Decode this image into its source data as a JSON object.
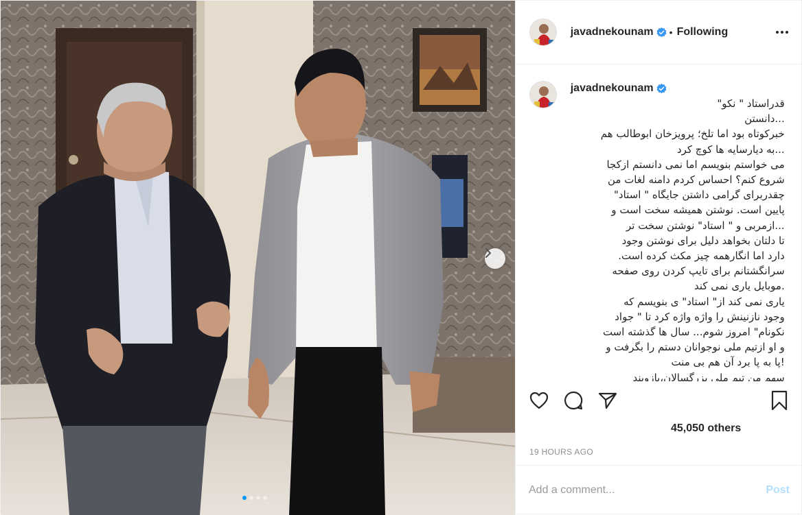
{
  "post": {
    "author": {
      "username": "javadnekounam",
      "verified": true,
      "follow_status": "Following",
      "separator": "•"
    },
    "caption": {
      "username": "javadnekounam",
      "text": "قدراستاد \" نکو\"\n...دانستن\nخبرکوتاه بود اما تلخ؛ پرویزخان ابوطالب هم\n...به دیارسایه ها کوچ کرد\nمی خواستم بنویسم اما نمی دانستم ازکجا\nشروع کنم؟ احساس کردم دامنه لغات من\nچقدربرای گرامی داشتن جایگاه \" استاد\"\nپایین است. نوشتن همیشه سخت است و\n...ازمربی و \" استاد\" نوشتن سخت تر\nتا دلتان بخواهد دلیل برای نوشتن وجود\nدارد اما انگارهمه چیز مکث کرده است.\nسرانگشتانم برای تایپ کردن روی صفحه\n.موبایل یاری نمی کند\nیاری نمی کند از\" استاد\" ی بنویسم که\nوجود نازنینش را واژه واژه کرد تا \" جواد\nنکونام\" امروز شوم... سال ها گذشته است\nو او ازتیم ملی نوجوانان دستم را بگرفت و\n!پا به پا برد آن هم بی منت\nسهم من تیم ملی بزرگسالان،بازوبند"
    },
    "likes_text": "45,050 others",
    "timestamp": "19 HOURS AGO",
    "comment_box": {
      "placeholder": "Add a comment...",
      "post_label": "Post"
    },
    "carousel": {
      "count": 4,
      "active_index": 0
    },
    "icons": {
      "more": "more-options-icon",
      "like": "heart-icon",
      "comment": "comment-icon",
      "share": "share-icon",
      "save": "bookmark-icon",
      "next": "chevron-right-icon",
      "verified": "verified-badge-icon"
    },
    "colors": {
      "accent": "#0095f6",
      "post_disabled": "#b2dffc",
      "meta_gray": "#8e8e8e"
    }
  }
}
